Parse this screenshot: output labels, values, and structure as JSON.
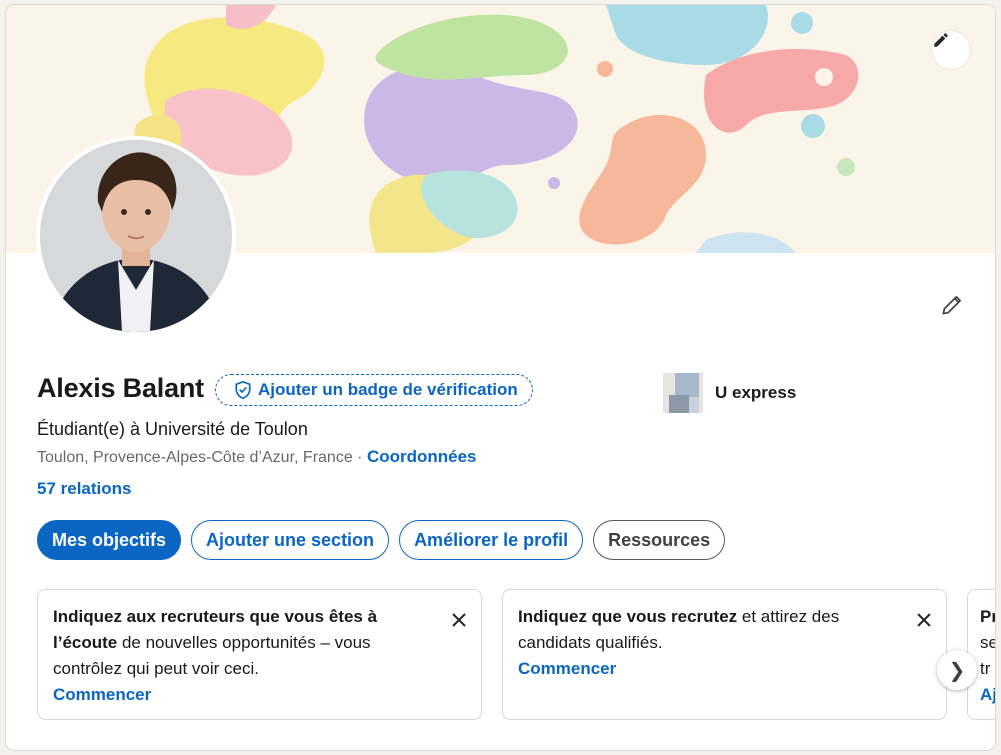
{
  "profile": {
    "name": "Alexis Balant",
    "badge_label": "Ajouter un badge de vérification",
    "headline": "Étudiant(e) à Université de Toulon",
    "location": "Toulon, Provence-Alpes-Côte d’Azur, France",
    "separator": " · ",
    "contact_label": "Coordonnées",
    "relations": "57 relations"
  },
  "company": {
    "name": "U express"
  },
  "actions": [
    {
      "label": "Mes objectifs"
    },
    {
      "label": "Ajouter une section"
    },
    {
      "label": "Améliorer le profil"
    },
    {
      "label": "Ressources"
    }
  ],
  "promos": [
    {
      "bold1": "Indiquez aux recruteurs que vous êtes à l’écoute",
      "text": " de nouvelles opportunités – vous contrôlez qui peut voir ceci.",
      "cta": "Commencer"
    },
    {
      "bold1": "Indiquez que vous recrutez",
      "text": " et attirez des candidats qualifiés.",
      "cta": "Commencer"
    },
    {
      "bold1": "Pr",
      "text": "se tr",
      "cta": "Aj"
    }
  ],
  "icons": {
    "banner_edit": "pencil-icon",
    "profile_edit": "pencil-icon",
    "badge": "shield-check-icon",
    "close": "close-icon",
    "next": "chevron-right-icon"
  },
  "colors": {
    "accent": "#0a66c2",
    "text": "#191919"
  },
  "next_glyph": "❯"
}
